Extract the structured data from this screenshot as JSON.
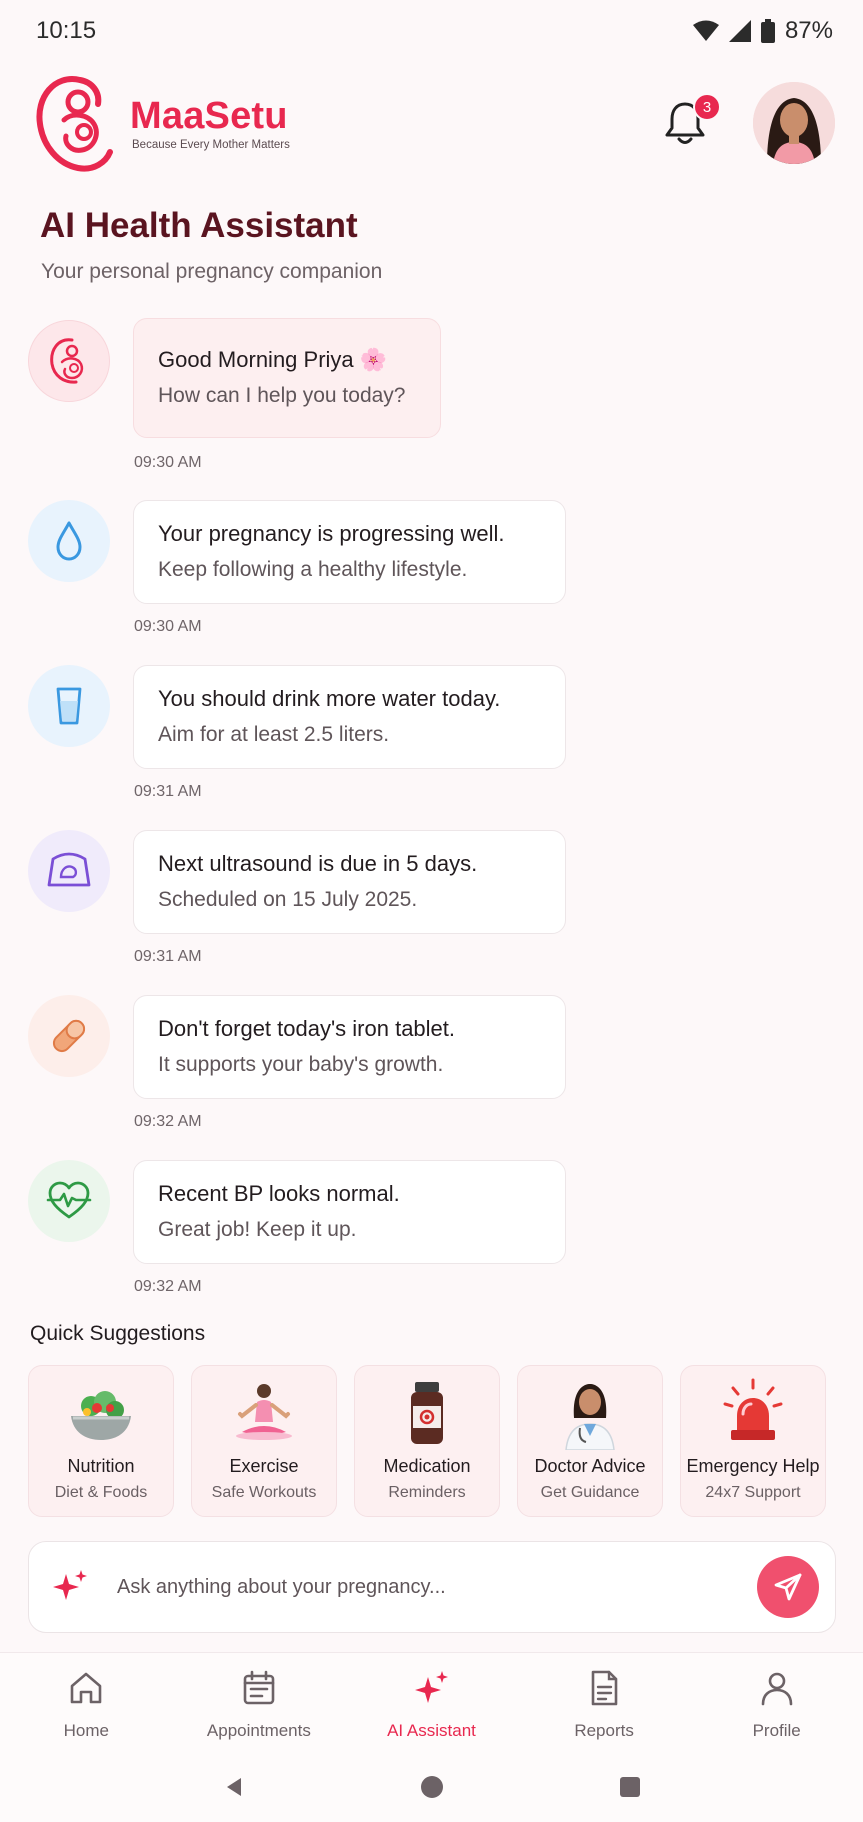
{
  "status_bar": {
    "time": "10:15",
    "battery": "87%"
  },
  "header": {
    "brand_name": "MaaSetu",
    "tagline": "Because Every Mother Matters",
    "notification_count": "3"
  },
  "page": {
    "title": "AI Health Assistant",
    "subtitle": "Your personal pregnancy companion"
  },
  "messages": [
    {
      "icon": "mother-baby-icon",
      "title": "Good Morning Priya",
      "emoji": "🌸",
      "text": "How can I help you today?",
      "time": "09:30 AM"
    },
    {
      "icon": "water-drop-icon",
      "title": "Your pregnancy is progressing well.",
      "text": "Keep following a healthy lifestyle.",
      "time": "09:30 AM"
    },
    {
      "icon": "water-glass-icon",
      "title": "You should drink more water today.",
      "text": "Aim for at least 2.5 liters.",
      "time": "09:31 AM"
    },
    {
      "icon": "ultrasound-icon",
      "title": "Next ultrasound is due in 5 days.",
      "text": "Scheduled on 15 July 2025.",
      "time": "09:31 AM"
    },
    {
      "icon": "pill-icon",
      "title": "Don't forget today's iron tablet.",
      "text": "It supports your baby's growth.",
      "time": "09:32 AM"
    },
    {
      "icon": "heart-pulse-icon",
      "title": "Recent BP looks normal.",
      "text": "Great job! Keep it up.",
      "time": "09:32 AM"
    }
  ],
  "quick_suggestions": {
    "title": "Quick Suggestions",
    "items": [
      {
        "label": "Nutrition",
        "sub": "Diet & Foods",
        "icon": "salad-icon"
      },
      {
        "label": "Exercise",
        "sub": "Safe Workouts",
        "icon": "yoga-icon"
      },
      {
        "label": "Medication",
        "sub": "Reminders",
        "icon": "medicine-bottle-icon"
      },
      {
        "label": "Doctor Advice",
        "sub": "Get Guidance",
        "icon": "doctor-icon"
      },
      {
        "label": "Emergency Help",
        "sub": "24x7 Support",
        "icon": "siren-icon"
      }
    ]
  },
  "ask": {
    "placeholder": "Ask anything about your pregnancy..."
  },
  "bottom_nav": [
    {
      "label": "Home",
      "icon": "home-icon"
    },
    {
      "label": "Appointments",
      "icon": "calendar-icon"
    },
    {
      "label": "AI Assistant",
      "icon": "sparkle-icon",
      "active": true
    },
    {
      "label": "Reports",
      "icon": "document-icon"
    },
    {
      "label": "Profile",
      "icon": "person-icon"
    }
  ],
  "colors": {
    "brand": "#e8284f",
    "title": "#5a1420",
    "send_button": "#f0506e"
  }
}
